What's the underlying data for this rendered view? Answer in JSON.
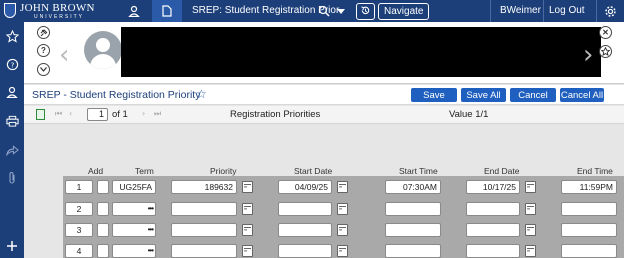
{
  "app": {
    "logo_name": "JOHN BROWN",
    "logo_sub": "UNIVERSITY",
    "form_title": "SREP: Student Registration Prior",
    "navigate_label": "Navigate",
    "user": "BWeimer",
    "logout_label": "Log Out"
  },
  "form": {
    "title": "SREP - Student Registration Priority",
    "buttons": {
      "save": "Save",
      "save_all": "Save All",
      "cancel": "Cancel",
      "cancel_all": "Cancel All"
    }
  },
  "toolbar": {
    "page": "1",
    "of_text": "of 1",
    "section_title": "Registration Priorities",
    "value_text": "Value 1/1"
  },
  "grid": {
    "headers": {
      "add": "Add",
      "term": "Term",
      "priority": "Priority",
      "start_date": "Start Date",
      "start_time": "Start Time",
      "end_date": "End Date",
      "end_time": "End Time"
    },
    "rows": [
      {
        "num": "1",
        "term": "UG25FA",
        "priority": "189632",
        "start_date": "04/09/25",
        "start_time": "07:30AM",
        "end_date": "10/17/25",
        "end_time": "11:59PM"
      },
      {
        "num": "2",
        "term": "",
        "priority": "",
        "start_date": "",
        "start_time": "",
        "end_date": "",
        "end_time": ""
      },
      {
        "num": "3",
        "term": "",
        "priority": "",
        "start_date": "",
        "start_time": "",
        "end_date": "",
        "end_time": ""
      },
      {
        "num": "4",
        "term": "",
        "priority": "",
        "start_date": "",
        "start_time": "",
        "end_date": "",
        "end_time": ""
      }
    ]
  },
  "colors": {
    "header_bg": "#1c3f7a",
    "accent": "#1f5fbf"
  }
}
